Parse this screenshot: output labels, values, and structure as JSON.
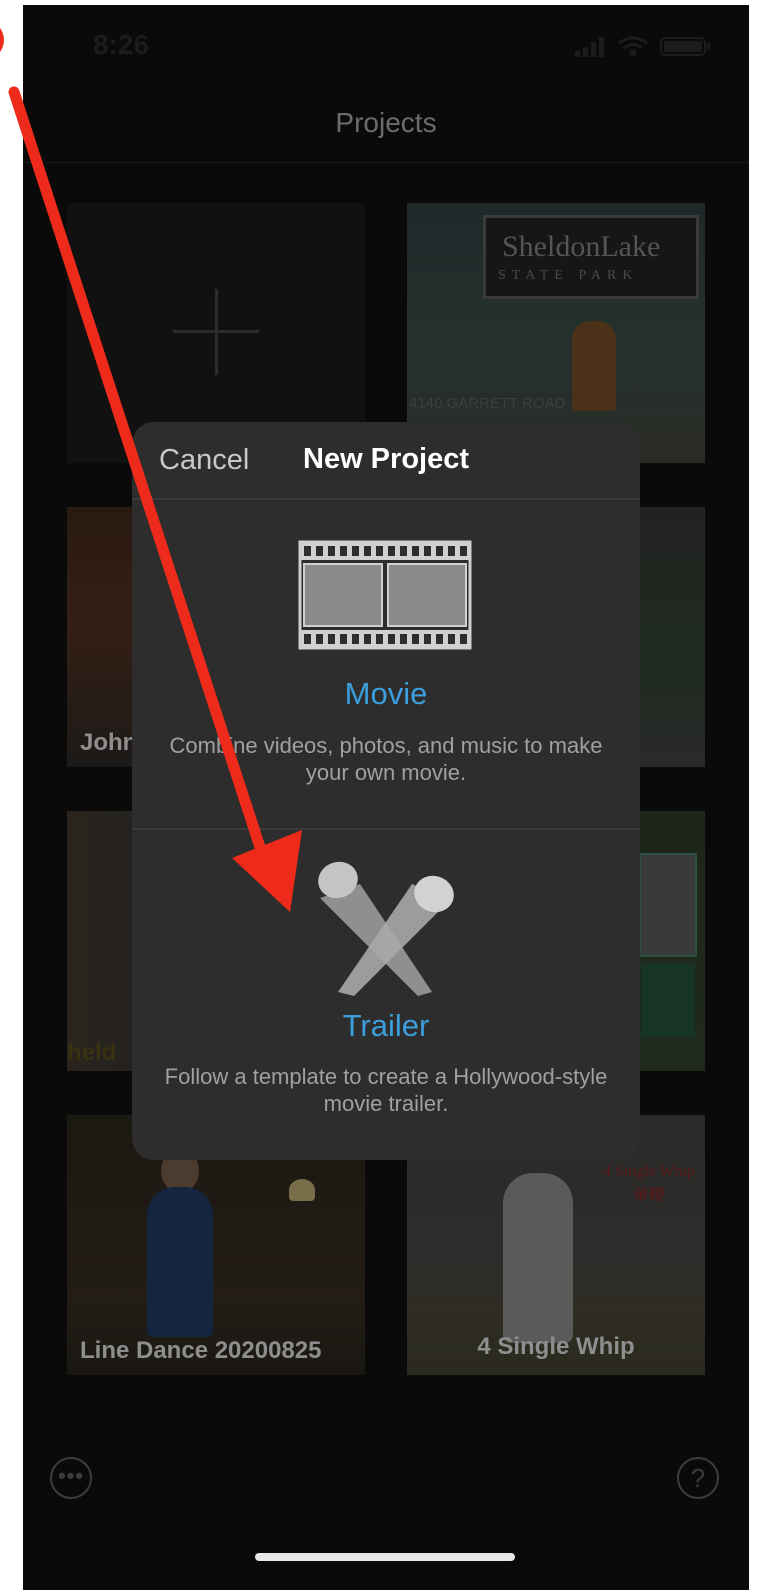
{
  "status": {
    "time": "8:26"
  },
  "nav": {
    "title": "Projects"
  },
  "projects": [
    {
      "label": ""
    },
    {
      "label": ""
    },
    {
      "label": "John"
    },
    {
      "label": ""
    },
    {
      "label": ""
    },
    {
      "label": ""
    },
    {
      "label": "Line Dance 20200825"
    },
    {
      "label": "4 Single Whip"
    }
  ],
  "thumb_text": {
    "sign_name": "SheldonLake",
    "sign_sub": "STATE PARK",
    "road": "4140 GARRETT ROAD",
    "held": "held",
    "whip_title": "4 Single Whip",
    "whip_title_cn": "单鞭"
  },
  "sheet": {
    "cancel": "Cancel",
    "title": "New Project",
    "options": [
      {
        "title": "Movie",
        "description": "Combine videos, photos, and music to make your own movie.",
        "icon": "film-strip-icon"
      },
      {
        "title": "Trailer",
        "description": "Follow a template to create a Hollywood-style movie trailer.",
        "icon": "spotlights-icon"
      }
    ]
  },
  "toolbar": {
    "more": "•••",
    "help": "?"
  },
  "colors": {
    "accent": "#3a9fdc",
    "annotation": "#ee2a1a",
    "sheet_bg": "#2d2d2d",
    "screen_bg": "#0a0a0a"
  }
}
